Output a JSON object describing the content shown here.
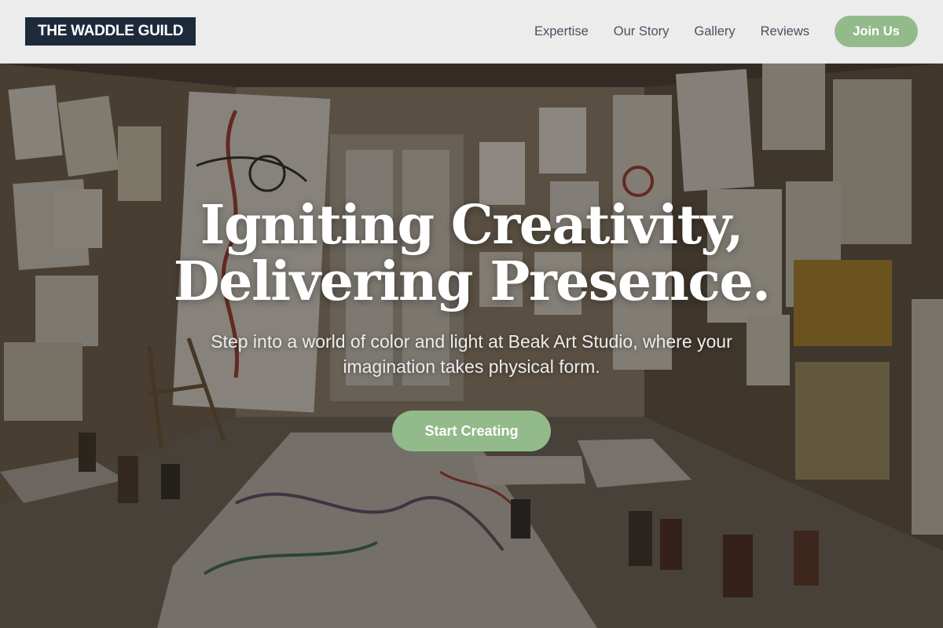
{
  "brand": {
    "name": "THE WADDLE GUILD"
  },
  "nav": {
    "items": [
      {
        "label": "Expertise"
      },
      {
        "label": "Our Story"
      },
      {
        "label": "Gallery"
      },
      {
        "label": "Reviews"
      }
    ],
    "cta_label": "Join Us"
  },
  "hero": {
    "headline_line1": "Igniting Creativity,",
    "headline_line2": "Delivering Presence.",
    "subtext": "Step into a world of color and light at Beak Art Studio, where your imagination takes physical form.",
    "cta_label": "Start Creating",
    "background": "art studio room with drawings covering walls and floor"
  },
  "colors": {
    "brand_navy": "#1d2a3b",
    "accent_green": "#93ba8a",
    "nav_text": "#47525f",
    "header_bg": "#ececec"
  }
}
